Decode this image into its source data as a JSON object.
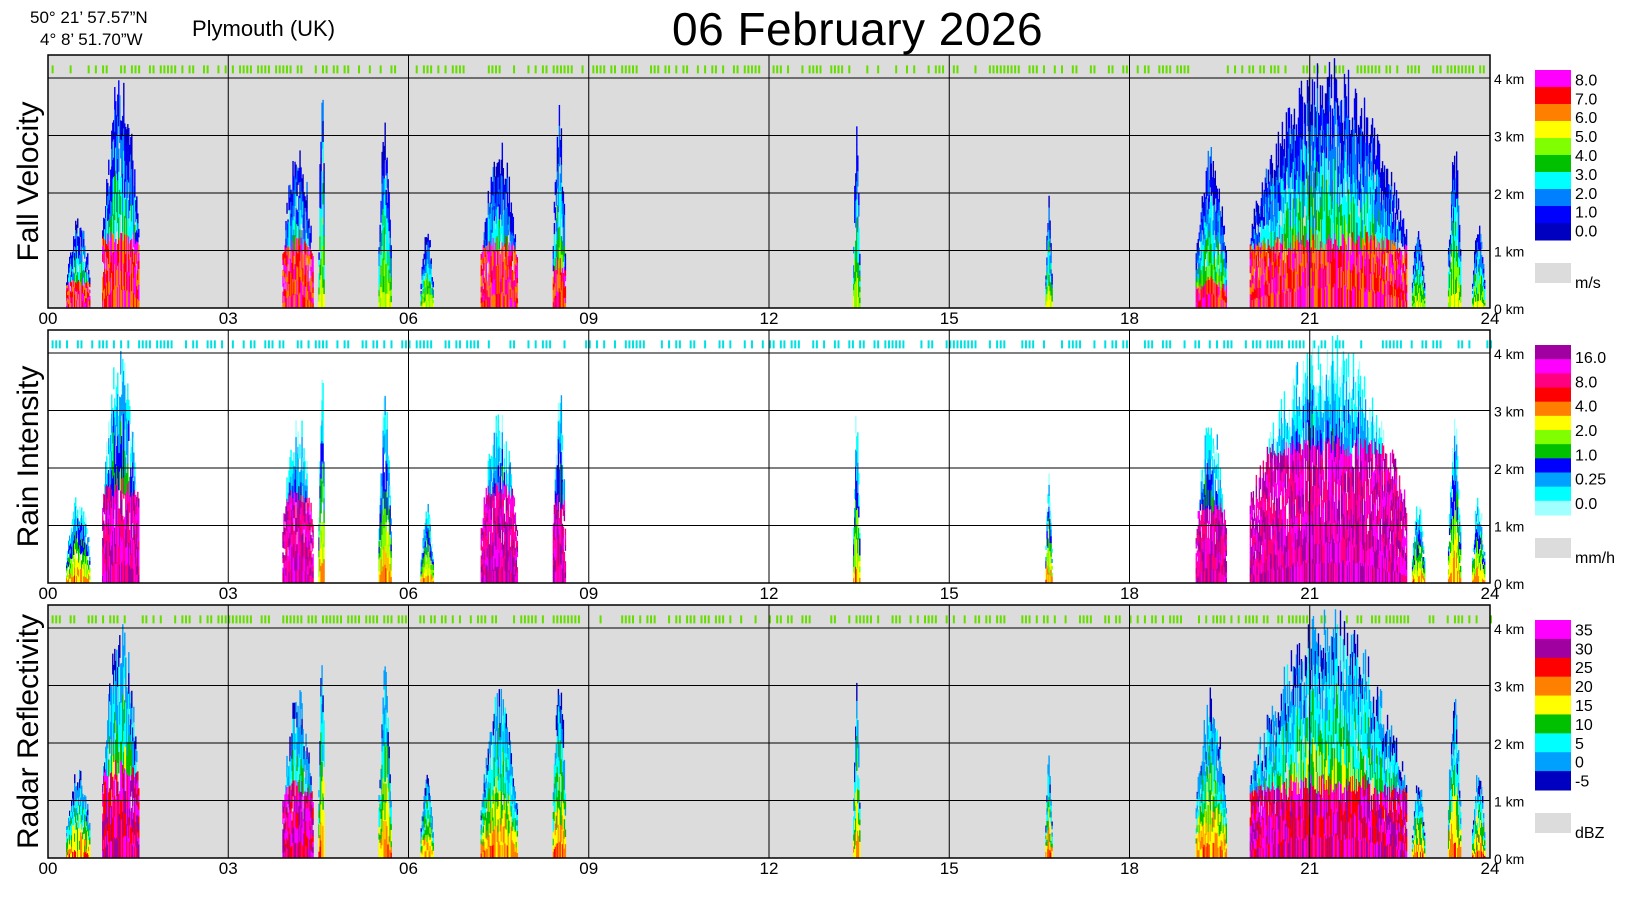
{
  "header": {
    "lat": "50° 21’ 57.57”N",
    "lon": "4°  8’ 51.70”W",
    "location": "Plymouth (UK)",
    "title": "06 February  2026"
  },
  "chart_data": [
    {
      "type": "heatmap",
      "ylabel": "Fall Velocity",
      "xlabel": "",
      "xticks": [
        "00",
        "03",
        "06",
        "09",
        "12",
        "15",
        "18",
        "21",
        "24"
      ],
      "yticks": [
        "0 km",
        "1 km",
        "2 km",
        "3 km",
        "4 km"
      ],
      "xlim": [
        0,
        24
      ],
      "ylim": [
        0,
        4.4
      ],
      "background": "#dcdcdc",
      "colorbar": {
        "unit": "m/s",
        "labels": [
          "8.0",
          "7.0",
          "6.0",
          "5.0",
          "4.0",
          "3.0",
          "2.0",
          "1.0",
          "0.0"
        ],
        "colors": [
          "#ff00ff",
          "#ff0000",
          "#ff7f00",
          "#ffff00",
          "#80ff00",
          "#00c000",
          "#00ffff",
          "#0080ff",
          "#0000ff",
          "#0000c0"
        ]
      },
      "clutter_line": {
        "height_km": 4.15,
        "color": "#66dd00"
      },
      "echoes": [
        {
          "start": 0.3,
          "end": 0.7,
          "top": 1.6,
          "core": 0.4
        },
        {
          "start": 0.9,
          "end": 1.5,
          "top": 4.3,
          "core": 1.1
        },
        {
          "start": 3.9,
          "end": 4.4,
          "top": 3.0,
          "core": 1.0
        },
        {
          "start": 4.5,
          "end": 4.6,
          "top": 4.0,
          "core": 0.0
        },
        {
          "start": 5.5,
          "end": 5.7,
          "top": 3.4,
          "core": 0.0
        },
        {
          "start": 6.2,
          "end": 6.4,
          "top": 1.5,
          "core": 0.0
        },
        {
          "start": 7.2,
          "end": 7.8,
          "top": 3.0,
          "core": 1.0
        },
        {
          "start": 8.4,
          "end": 8.6,
          "top": 3.6,
          "core": 0.6
        },
        {
          "start": 13.4,
          "end": 13.5,
          "top": 3.2,
          "core": 0.0
        },
        {
          "start": 16.6,
          "end": 16.7,
          "top": 2.0,
          "core": 0.0
        },
        {
          "start": 19.1,
          "end": 19.6,
          "top": 3.0,
          "core": 0.3
        },
        {
          "start": 20.0,
          "end": 22.6,
          "top": 4.4,
          "core": 1.0
        },
        {
          "start": 22.7,
          "end": 22.9,
          "top": 1.5,
          "core": 0.0
        },
        {
          "start": 23.3,
          "end": 23.5,
          "top": 3.0,
          "core": 0.0
        },
        {
          "start": 23.7,
          "end": 23.9,
          "top": 1.6,
          "core": 0.0
        }
      ]
    },
    {
      "type": "heatmap",
      "ylabel": "Rain Intensity",
      "xlabel": "",
      "xticks": [
        "00",
        "03",
        "06",
        "09",
        "12",
        "15",
        "18",
        "21",
        "24"
      ],
      "yticks": [
        "0 km",
        "1 km",
        "2 km",
        "3 km",
        "4 km"
      ],
      "xlim": [
        0,
        24
      ],
      "ylim": [
        0,
        4.4
      ],
      "background": "#ffffff",
      "colorbar": {
        "unit": "mm/h",
        "labels": [
          "16.0",
          "8.0",
          "4.0",
          "2.0",
          "1.0",
          "0.25",
          "0.0"
        ],
        "colors": [
          "#a000a0",
          "#ff00ff",
          "#ff0080",
          "#ff0000",
          "#ff8000",
          "#ffff00",
          "#80ff00",
          "#00c000",
          "#0000ff",
          "#00a0ff",
          "#00ffff",
          "#a0ffff"
        ]
      },
      "clutter_line": {
        "height_km": 4.15,
        "color": "#00e0e0"
      },
      "echoes": [
        {
          "start": 0.3,
          "end": 0.7,
          "top": 1.6,
          "core": 0.0
        },
        {
          "start": 0.9,
          "end": 1.5,
          "top": 4.3,
          "core": 1.5
        },
        {
          "start": 3.9,
          "end": 4.4,
          "top": 3.0,
          "core": 1.4
        },
        {
          "start": 4.5,
          "end": 4.6,
          "top": 4.0,
          "core": 0.0
        },
        {
          "start": 5.5,
          "end": 5.7,
          "top": 3.4,
          "core": 0.0
        },
        {
          "start": 6.2,
          "end": 6.4,
          "top": 1.5,
          "core": 0.0
        },
        {
          "start": 7.2,
          "end": 7.8,
          "top": 3.0,
          "core": 1.5
        },
        {
          "start": 8.4,
          "end": 8.6,
          "top": 3.6,
          "core": 1.3
        },
        {
          "start": 13.4,
          "end": 13.5,
          "top": 3.2,
          "core": 0.0
        },
        {
          "start": 16.6,
          "end": 16.7,
          "top": 2.0,
          "core": 0.0
        },
        {
          "start": 19.1,
          "end": 19.6,
          "top": 3.0,
          "core": 1.2
        },
        {
          "start": 20.0,
          "end": 22.6,
          "top": 4.4,
          "core": 2.2
        },
        {
          "start": 22.7,
          "end": 22.9,
          "top": 1.5,
          "core": 0.0
        },
        {
          "start": 23.3,
          "end": 23.5,
          "top": 3.0,
          "core": 0.0
        },
        {
          "start": 23.7,
          "end": 23.9,
          "top": 1.6,
          "core": 0.0
        }
      ]
    },
    {
      "type": "heatmap",
      "ylabel": "Radar Reflectivity",
      "xlabel": "",
      "xticks": [
        "00",
        "03",
        "06",
        "09",
        "12",
        "15",
        "18",
        "21",
        "24"
      ],
      "yticks": [
        "0 km",
        "1 km",
        "2 km",
        "3 km",
        "4 km"
      ],
      "xlim": [
        0,
        24
      ],
      "ylim": [
        0,
        4.4
      ],
      "background": "#dcdcdc",
      "colorbar": {
        "unit": "dBZ",
        "labels": [
          "35",
          "30",
          "25",
          "20",
          "15",
          "10",
          "5",
          "0",
          "-5"
        ],
        "colors": [
          "#ff00ff",
          "#a000a0",
          "#ff0000",
          "#ff8000",
          "#ffff00",
          "#00c000",
          "#00ffff",
          "#00a0ff",
          "#0000c0"
        ]
      },
      "clutter_line": {
        "height_km": 4.15,
        "color": "#66dd00"
      },
      "echoes": [
        {
          "start": 0.3,
          "end": 0.7,
          "top": 1.6,
          "core": 0.0
        },
        {
          "start": 0.9,
          "end": 1.5,
          "top": 4.3,
          "core": 1.4
        },
        {
          "start": 3.9,
          "end": 4.4,
          "top": 3.0,
          "core": 1.1
        },
        {
          "start": 4.5,
          "end": 4.6,
          "top": 4.0,
          "core": 0.0
        },
        {
          "start": 5.5,
          "end": 5.7,
          "top": 3.4,
          "core": 0.0
        },
        {
          "start": 6.2,
          "end": 6.4,
          "top": 1.5,
          "core": 0.0
        },
        {
          "start": 7.2,
          "end": 7.8,
          "top": 3.0,
          "core": 0.0
        },
        {
          "start": 8.4,
          "end": 8.6,
          "top": 3.6,
          "core": 0.0
        },
        {
          "start": 13.4,
          "end": 13.5,
          "top": 3.2,
          "core": 0.0
        },
        {
          "start": 16.6,
          "end": 16.7,
          "top": 2.0,
          "core": 0.0
        },
        {
          "start": 19.1,
          "end": 19.6,
          "top": 3.0,
          "core": 0.0
        },
        {
          "start": 20.0,
          "end": 22.6,
          "top": 4.4,
          "core": 1.1
        },
        {
          "start": 22.7,
          "end": 22.9,
          "top": 1.5,
          "core": 0.0
        },
        {
          "start": 23.3,
          "end": 23.5,
          "top": 3.0,
          "core": 0.0
        },
        {
          "start": 23.7,
          "end": 23.9,
          "top": 1.6,
          "core": 0.0
        }
      ]
    }
  ]
}
